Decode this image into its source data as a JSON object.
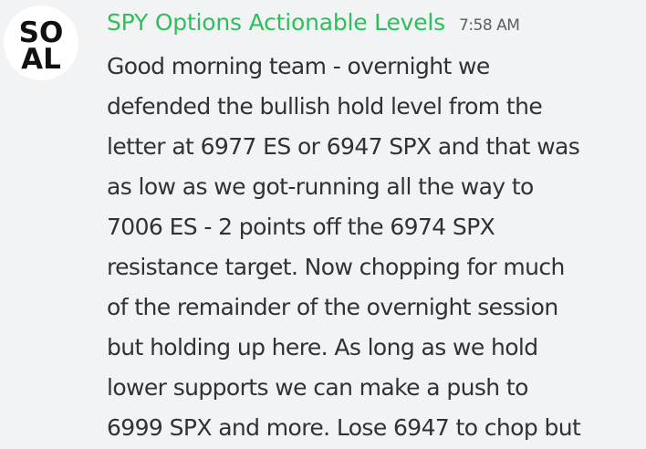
{
  "message": {
    "author": {
      "name": "SPY Options Actionable Levels",
      "name_color": "#2fbf5a",
      "avatar_text_top": "SO",
      "avatar_text_bottom": "AL"
    },
    "timestamp": "7:58 AM",
    "content": "Good morning team - overnight we\ndefended the bullish hold level from the\nletter at 6977 ES or 6947 SPX and that was\nas low as we got-running all the way to\n7006 ES - 2 points off the 6974 SPX\nresistance target. Now chopping for much\nof the remainder of the overnight session\nbut holding up here.  As long as we hold\nlower supports we can make a push to\n6999 SPX and more.  Lose 6947 to chop but"
  }
}
